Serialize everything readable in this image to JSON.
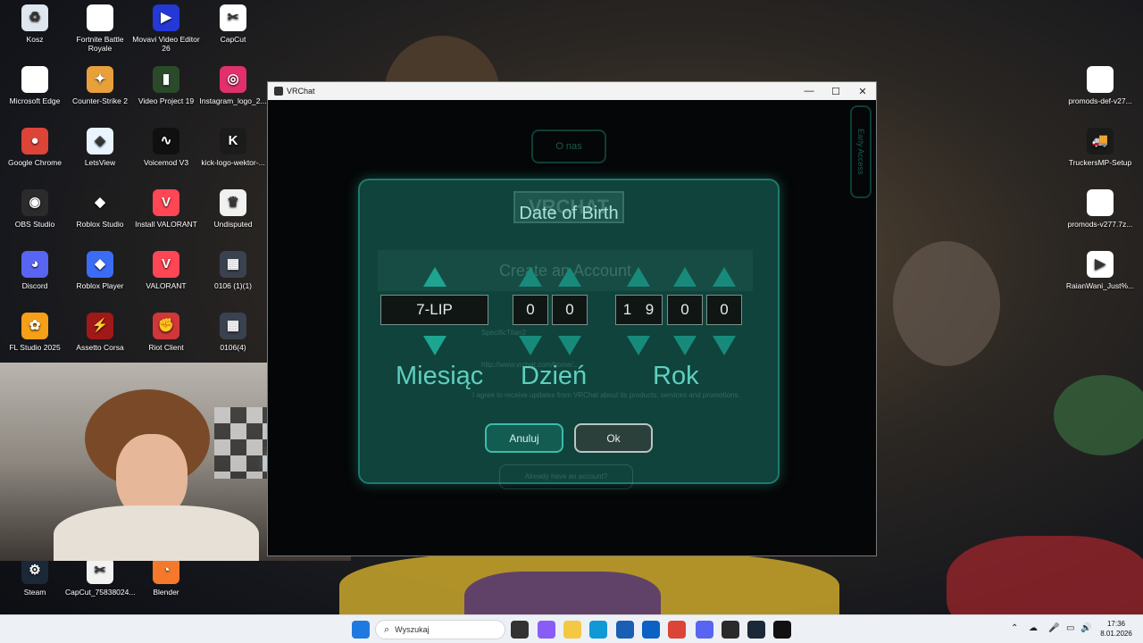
{
  "desktop": {
    "left_icons": [
      {
        "label": "Kosz",
        "icon": "recycle-bin-icon",
        "color": "#dfe6ee",
        "glyph": "♻"
      },
      {
        "label": "Fortnite Battle Royale",
        "icon": "file-icon",
        "color": "#ffffff",
        "glyph": ""
      },
      {
        "label": "Movavi Video Editor 26",
        "icon": "movavi-icon",
        "color": "#2438d6",
        "glyph": "▶"
      },
      {
        "label": "CapCut",
        "icon": "capcut-icon",
        "color": "#ffffff",
        "glyph": "✂"
      },
      {
        "label": "Microsoft Edge",
        "icon": "file-icon",
        "color": "#ffffff",
        "glyph": ""
      },
      {
        "label": "Counter-Strike 2",
        "icon": "cs2-icon",
        "color": "#e8a03a",
        "glyph": "✦"
      },
      {
        "label": "Video Project 19",
        "icon": "video-project-icon",
        "color": "#2a4a2a",
        "glyph": "▮"
      },
      {
        "label": "Instagram_logo_2...",
        "icon": "instagram-icon",
        "color": "#e1306c",
        "glyph": "◎"
      },
      {
        "label": "Google Chrome",
        "icon": "chrome-icon",
        "color": "#db4437",
        "glyph": "●"
      },
      {
        "label": "LetsView",
        "icon": "letsview-icon",
        "color": "#e9f4ff",
        "glyph": "◈"
      },
      {
        "label": "Voicemod V3",
        "icon": "voicemod-icon",
        "color": "#101010",
        "glyph": "∿"
      },
      {
        "label": "kick-logo-wektor-...",
        "icon": "kick-icon",
        "color": "#1b1b1b",
        "glyph": "K"
      },
      {
        "label": "OBS Studio",
        "icon": "obs-icon",
        "color": "#2b2b2b",
        "glyph": "◉"
      },
      {
        "label": "Roblox Studio",
        "icon": "roblox-studio-icon",
        "color": "#1d1d1d",
        "glyph": "◆"
      },
      {
        "label": "Install VALORANT",
        "icon": "valorant-icon",
        "color": "#ff4655",
        "glyph": "V"
      },
      {
        "label": "Undisputed",
        "icon": "undisputed-icon",
        "color": "#f1f1f1",
        "glyph": "♛"
      },
      {
        "label": "Discord",
        "icon": "discord-icon",
        "color": "#5865f2",
        "glyph": "◕"
      },
      {
        "label": "Roblox Player",
        "icon": "roblox-icon",
        "color": "#3b6cf5",
        "glyph": "◆"
      },
      {
        "label": "VALORANT",
        "icon": "valorant-icon",
        "color": "#ff4655",
        "glyph": "V"
      },
      {
        "label": "0106 (1)(1)",
        "icon": "video-file-icon",
        "color": "#3a4250",
        "glyph": "▦"
      },
      {
        "label": "FL Studio 2025",
        "icon": "fl-studio-icon",
        "color": "#f6a018",
        "glyph": "✿"
      },
      {
        "label": "Assetto Corsa",
        "icon": "assetto-corsa-icon",
        "color": "#a11818",
        "glyph": "⚡"
      },
      {
        "label": "Riot Client",
        "icon": "riot-client-icon",
        "color": "#d13639",
        "glyph": "✊"
      },
      {
        "label": "0106(4)",
        "icon": "video-file-icon",
        "color": "#3a4250",
        "glyph": "▦"
      },
      {
        "label": "Steam",
        "icon": "steam-icon",
        "color": "#1b2838",
        "glyph": "⚙"
      },
      {
        "label": "CapCut_75838024...",
        "icon": "capcut-file-icon",
        "color": "#f2f2f2",
        "glyph": "✂"
      },
      {
        "label": "Blender",
        "icon": "blender-icon",
        "color": "#f5792a",
        "glyph": "◔"
      }
    ],
    "right_icons": [
      {
        "label": "promods-def-v27...",
        "icon": "file-icon",
        "color": "#ffffff",
        "glyph": ""
      },
      {
        "label": "TruckersMP-Setup",
        "icon": "truckersmp-icon",
        "color": "#1a1a1a",
        "glyph": "🚚"
      },
      {
        "label": "promods-v277.7z...",
        "icon": "file-icon",
        "color": "#ffffff",
        "glyph": ""
      },
      {
        "label": "RaianWani_Just%...",
        "icon": "media-file-icon",
        "color": "#ffffff",
        "glyph": "▶"
      }
    ]
  },
  "window": {
    "title": "VRChat",
    "minimize": "—",
    "maximize": "☐",
    "close": "✕"
  },
  "background_ui": {
    "top_button": "O nas",
    "logo": "VRCHAT",
    "heading": "Create an Account",
    "field_label": "SpecificTitan2",
    "link": "http://www.vrchat.com/home/...",
    "agree": "I agree to receive updates from VRChat about its products, services and promotions.",
    "footer_link": "Already have an account?",
    "side_label": "Early Access"
  },
  "dialog": {
    "title": "Date of Birth",
    "month_value": "7-LIP",
    "day_digits": [
      "0",
      "0"
    ],
    "year_digits": [
      "1",
      "9",
      "0",
      "0"
    ],
    "month_label": "Miesiąc",
    "day_label": "Dzień",
    "year_label": "Rok",
    "cancel_label": "Anuluj",
    "ok_label": "Ok",
    "accent": "#1ea592"
  },
  "taskbar": {
    "search_placeholder": "Wyszukaj",
    "apps": [
      {
        "icon": "windows-start-icon",
        "color": "#1f7ae0"
      },
      {
        "icon": "task-view-icon",
        "color": "#333333"
      },
      {
        "icon": "copilot-icon",
        "color": "#8a5cf6"
      },
      {
        "icon": "file-explorer-icon",
        "color": "#f4c842"
      },
      {
        "icon": "edge-icon",
        "color": "#0f9ad6"
      },
      {
        "icon": "store-icon",
        "color": "#1a5fb4"
      },
      {
        "icon": "outlook-icon",
        "color": "#0b61c4"
      },
      {
        "icon": "chrome-icon",
        "color": "#db4437"
      },
      {
        "icon": "discord-icon",
        "color": "#5865f2"
      },
      {
        "icon": "obs-icon",
        "color": "#2b2b2b"
      },
      {
        "icon": "steam-icon",
        "color": "#1b2838"
      },
      {
        "icon": "vrchat-icon",
        "color": "#111111"
      }
    ],
    "time": "17:36",
    "date": "8.01.2026"
  }
}
